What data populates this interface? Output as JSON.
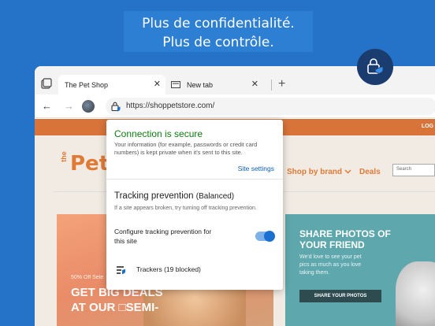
{
  "headline": {
    "line1": "Plus de confidentialité.",
    "line2": "Plus de contrôle."
  },
  "tabs": [
    {
      "label": "The Pet Shop",
      "close": "✕"
    },
    {
      "label": "New tab",
      "close": "✕"
    }
  ],
  "new_tab_symbol": "+",
  "toolbar": {
    "back": "←",
    "forward": "→",
    "url": "https://shoppetstore.com/"
  },
  "site": {
    "login": "LOG",
    "logo_the": "the",
    "logo_pet": "Pet",
    "nav": {
      "shop_by_brand": "Shop by brand",
      "deals": "Deals"
    },
    "search_placeholder": "Search",
    "promo_left": {
      "small": "50% Off Sele",
      "headline": "GET BIG DEALS AT OUR □SEMI-"
    },
    "promo_right": {
      "title": "SHARE PHOTOS OF YOUR FRIEND",
      "body": "We'd love to see your pet pics as much as you love taking them.",
      "button": "SHARE YOUR PHOTOS"
    }
  },
  "popup": {
    "title": "Connection is secure",
    "description": "Your information (for example, passwords or credit card numbers) is kept private when it's sent to this site.",
    "settings_link": "Site settings",
    "tracking_title": "Tracking prevention",
    "tracking_mode": "(Balanced)",
    "tracking_hint": "If a site appears broken, try turning off tracking prevention.",
    "configure_label": "Configure tracking prevention for this site",
    "toggle_on": true,
    "trackers_label": "Trackers (19 blocked)"
  },
  "colors": {
    "background": "#2473c8",
    "secure_green": "#107c10",
    "link_blue": "#0a5fb3",
    "brand_orange": "#e07a36",
    "badge_navy": "#1a3c6e"
  }
}
